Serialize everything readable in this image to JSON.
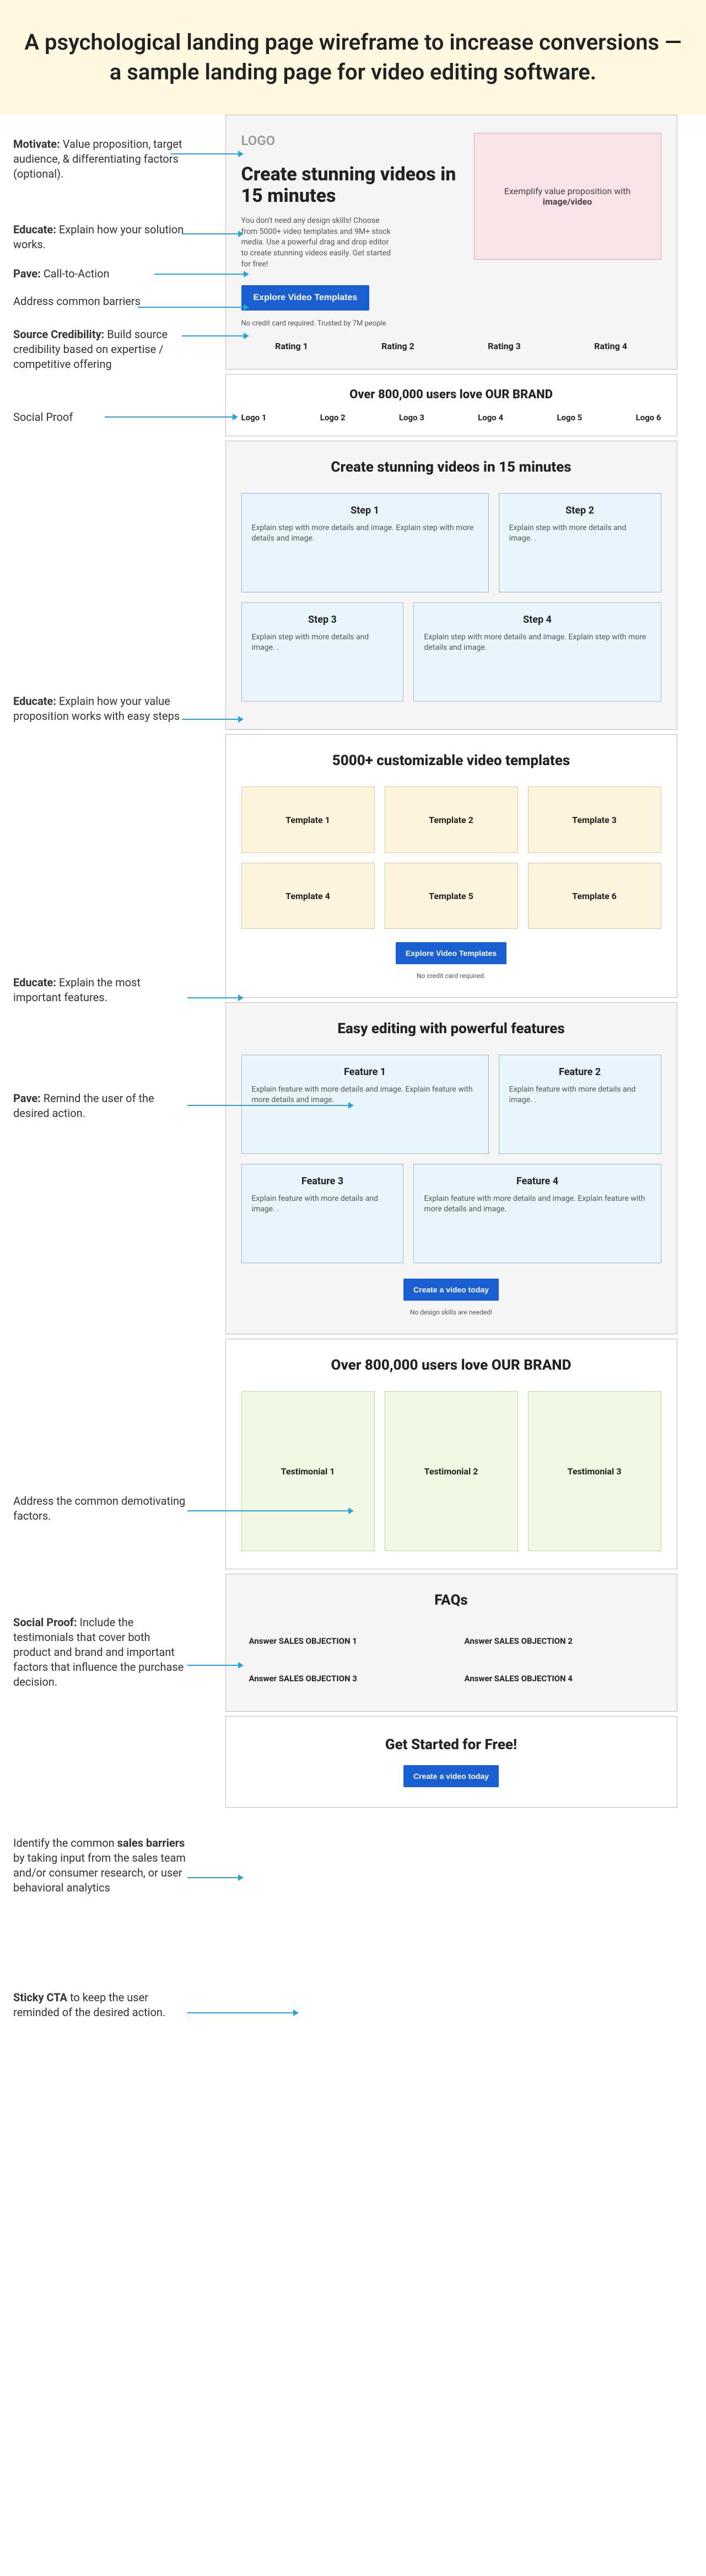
{
  "title": "A psychological landing page wireframe to increase conversions —a sample landing page for video editing software.",
  "annotations": {
    "motivate": "<strong>Motivate:</strong> Value proposition, target audience, & differentiating factors (optional).",
    "educate1": "<strong>Educate:</strong> Explain how your solution works.",
    "pave1": "<strong>Pave:</strong> Call-to-Action",
    "barriers": "Address common barriers",
    "credibility": "<strong>Source Credibility:</strong> Build source credibility based on expertise / competitive offering",
    "social1": "Social Proof",
    "educate2": "<strong>Educate:</strong> Explain how your value proposition works with easy steps",
    "educate3": "<strong>Educate:</strong> Explain the most important features.",
    "pave2": "<strong>Pave:</strong> Remind the user of the desired action.",
    "demotivate": "Address the common demotivating factors.",
    "social2": "<strong>Social Proof:</strong> Include the testimonials that cover both product and brand and important factors that influence the purchase decision.",
    "objections": "Identify the common <strong>sales barriers</strong> by taking input from the sales team and/or consumer research, or user behavioral analytics",
    "sticky": "<strong>Sticky CTA</strong> to keep the user reminded of the desired action."
  },
  "hero": {
    "logo": "LOGO",
    "h1": "Create stunning videos in 15 minutes",
    "sub": "You don't need any design skills! Choose from 5000+ video templates and 9M+ stock media. Use a powerful drag and drop editor to create stunning videos easily. Get started for free!",
    "cta": "Explore Video Templates",
    "barrier": "No credit card required. Trusted by 7M people",
    "media_label_prefix": "Exemplify value proposition with ",
    "media_label_bold": "image/video"
  },
  "ratings": [
    "Rating 1",
    "Rating 2",
    "Rating 3",
    "Rating 4"
  ],
  "social": {
    "heading": "Over 800,000 users love OUR BRAND",
    "logos": [
      "Logo 1",
      "Logo 2",
      "Logo 3",
      "Logo 4",
      "Logo 5",
      "Logo 6"
    ]
  },
  "steps": {
    "heading": "Create stunning videos in 15 minutes",
    "row1": [
      {
        "title": "Step 1",
        "body": "Explain step with more details and image. Explain step with more details and image."
      },
      {
        "title": "Step 2",
        "body": "Explain step with more details and image. ."
      }
    ],
    "row2": [
      {
        "title": "Step 3",
        "body": "Explain step with more details and image. ."
      },
      {
        "title": "Step 4",
        "body": "Explain step with more details and image. Explain step with more details and image."
      }
    ]
  },
  "templates": {
    "heading": "5000+ customizable video templates",
    "row1": [
      "Template 1",
      "Template 2",
      "Template 3"
    ],
    "row2": [
      "Template 4",
      "Template 5",
      "Template 6"
    ],
    "cta": "Explore Video Templates",
    "note": "No credit card required."
  },
  "features": {
    "heading": "Easy editing with powerful features",
    "row1": [
      {
        "title": "Feature 1",
        "body": "Explain feature with more details and image. Explain feature with more details and image."
      },
      {
        "title": "Feature 2",
        "body": "Explain feature with more details and image. ."
      }
    ],
    "row2": [
      {
        "title": "Feature 3",
        "body": "Explain feature with more details and image. ."
      },
      {
        "title": "Feature 4",
        "body": "Explain feature with more details and image. Explain feature with more details and image."
      }
    ],
    "cta": "Create a video today",
    "note": "No design skills are needed!"
  },
  "testimonials": {
    "heading": "Over 800,000 users love OUR BRAND",
    "items": [
      "Testimonial 1",
      "Testimonial 2",
      "Testimonial 3"
    ]
  },
  "faqs": {
    "heading": "FAQs",
    "items": [
      "Answer SALES OBJECTION 1",
      "Answer SALES OBJECTION 2",
      "Answer SALES OBJECTION 3",
      "Answer SALES OBJECTION 4"
    ]
  },
  "sticky": {
    "heading": "Get Started for Free!",
    "cta": "Create a video today"
  }
}
